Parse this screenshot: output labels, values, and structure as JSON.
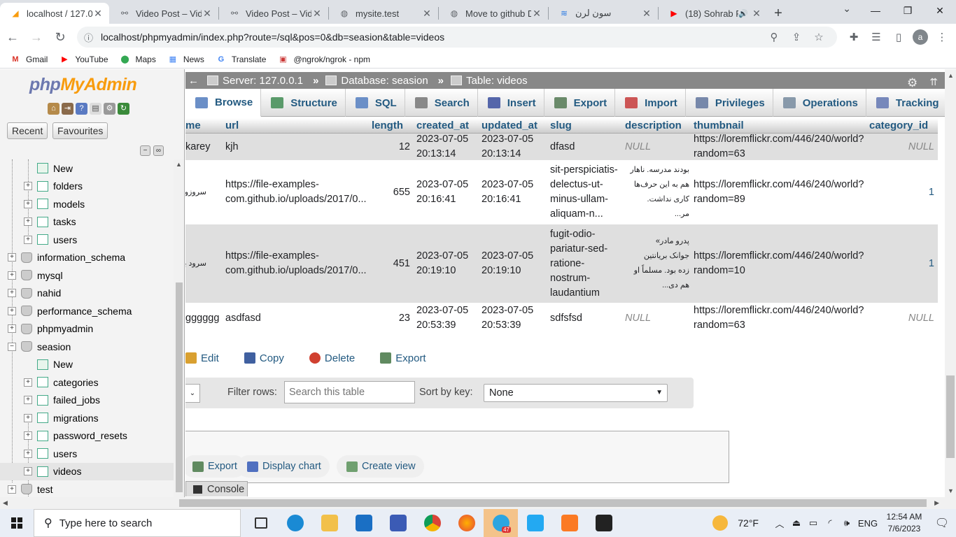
{
  "browser": {
    "tabs": [
      {
        "title": "localhost / 127.0.0",
        "icon": "phpmyadmin-favicon",
        "active": true
      },
      {
        "title": "Video Post – Vide",
        "icon": "link-icon"
      },
      {
        "title": "Video Post – Vide",
        "icon": "link-icon"
      },
      {
        "title": "mysite.test",
        "icon": "globe-icon"
      },
      {
        "title": "Move to github D",
        "icon": "globe-icon"
      },
      {
        "title": "سون لرن",
        "icon": "sevenlearn-favicon"
      },
      {
        "title": "(18) Sohrab P",
        "icon": "youtube-favicon"
      }
    ],
    "url": "localhost/phpmyadmin/index.php?route=/sql&pos=0&db=seasion&table=videos",
    "avatar_letter": "a",
    "bookmarks": [
      {
        "label": "Gmail",
        "icon": "gmail-icon"
      },
      {
        "label": "YouTube",
        "icon": "youtube-icon"
      },
      {
        "label": "Maps",
        "icon": "maps-icon"
      },
      {
        "label": "News",
        "icon": "news-icon"
      },
      {
        "label": "Translate",
        "icon": "translate-icon"
      },
      {
        "label": "@ngrok/ngrok - npm",
        "icon": "npm-icon"
      }
    ]
  },
  "pma": {
    "logo_php": "php",
    "logo_myadmin": "MyAdmin",
    "recent_label": "Recent",
    "favourites_label": "Favourites",
    "tree": [
      {
        "label": "New",
        "level": 2,
        "kind": "new"
      },
      {
        "label": "folders",
        "level": 2,
        "kind": "table"
      },
      {
        "label": "models",
        "level": 2,
        "kind": "table"
      },
      {
        "label": "tasks",
        "level": 2,
        "kind": "table"
      },
      {
        "label": "users",
        "level": 2,
        "kind": "table"
      },
      {
        "label": "information_schema",
        "level": 1,
        "kind": "db"
      },
      {
        "label": "mysql",
        "level": 1,
        "kind": "db"
      },
      {
        "label": "nahid",
        "level": 1,
        "kind": "db"
      },
      {
        "label": "performance_schema",
        "level": 1,
        "kind": "db"
      },
      {
        "label": "phpmyadmin",
        "level": 1,
        "kind": "db"
      },
      {
        "label": "seasion",
        "level": 1,
        "kind": "db-open"
      },
      {
        "label": "New",
        "level": 2,
        "kind": "new"
      },
      {
        "label": "categories",
        "level": 2,
        "kind": "table"
      },
      {
        "label": "failed_jobs",
        "level": 2,
        "kind": "table"
      },
      {
        "label": "migrations",
        "level": 2,
        "kind": "table"
      },
      {
        "label": "password_resets",
        "level": 2,
        "kind": "table"
      },
      {
        "label": "users",
        "level": 2,
        "kind": "table"
      },
      {
        "label": "videos",
        "level": 2,
        "kind": "table",
        "selected": true
      },
      {
        "label": "test",
        "level": 1,
        "kind": "db"
      }
    ],
    "breadcrumb": {
      "server": "Server: 127.0.0.1",
      "database": "Database: seasion",
      "table": "Table: videos"
    },
    "tabs": [
      {
        "label": "Browse",
        "active": true,
        "color": "#6b8fc7"
      },
      {
        "label": "Structure",
        "color": "#5a9a6a"
      },
      {
        "label": "SQL",
        "color": "#6b8fc7"
      },
      {
        "label": "Search",
        "color": "#888"
      },
      {
        "label": "Insert",
        "color": "#5566aa"
      },
      {
        "label": "Export",
        "color": "#6a8a6a"
      },
      {
        "label": "Import",
        "color": "#c55"
      },
      {
        "label": "Privileges",
        "color": "#7788aa"
      },
      {
        "label": "Operations",
        "color": "#8899aa"
      },
      {
        "label": "Tracking",
        "color": "#7788bb"
      }
    ],
    "columns": [
      "me",
      "url",
      "length",
      "created_at",
      "updated_at",
      "slug",
      "description",
      "thumbnail",
      "category_id"
    ],
    "rows": [
      {
        "name": "karey",
        "url": "kjh",
        "length": "12",
        "created_date": "2023-07-05",
        "created_time": "20:13:14",
        "updated_date": "2023-07-05",
        "updated_time": "20:13:14",
        "slug": "dfasd",
        "description": "NULL",
        "thumb1": "https://loremflickr.com/446/240/world?",
        "thumb2": "random=63",
        "category_id": "NULL"
      },
      {
        "name": "سروزو ع",
        "url1": "https://file-examples-",
        "url2": "com.github.io/uploads/2017/0...",
        "length": "655",
        "created_date": "2023-07-05",
        "created_time": "20:16:41",
        "updated_date": "2023-07-05",
        "updated_time": "20:16:41",
        "slug": [
          "sit-perspiciatis-",
          "delectus-ut-",
          "minus-ullam-",
          "aliquam-n..."
        ],
        "description": [
          "بودند مدرسه. ناهار",
          "هم به این حرف‌ها",
          "کاری نداشت.",
          "مر..."
        ],
        "thumb1": "https://loremflickr.com/446/240/world?",
        "thumb2": "random=89",
        "category_id": "1"
      },
      {
        "name": "سرود بخ",
        "url1": "https://file-examples-",
        "url2": "com.github.io/uploads/2017/0...",
        "length": "451",
        "created_date": "2023-07-05",
        "created_time": "20:19:10",
        "updated_date": "2023-07-05",
        "updated_time": "20:19:10",
        "slug": [
          "fugit-odio-",
          "pariatur-sed-",
          "ratione-",
          "nostrum-",
          "laudantium"
        ],
        "description": [
          "پدرو مادر»",
          "جوانک بریانتین",
          "زده بود. مسلماً او",
          "هم دی..."
        ],
        "thumb1": "https://loremflickr.com/446/240/world?",
        "thumb2": "random=10",
        "category_id": "1"
      },
      {
        "name": "gggggg",
        "url": "asdfasd",
        "length": "23",
        "created_date": "2023-07-05",
        "created_time": "20:53:39",
        "updated_date": "2023-07-05",
        "updated_time": "20:53:39",
        "slug": "sdfsfsd",
        "description": "NULL",
        "thumb1": "https://loremflickr.com/446/240/world?",
        "thumb2": "random=63",
        "category_id": "NULL"
      }
    ],
    "row_actions": [
      "Edit",
      "Copy",
      "Delete",
      "Export"
    ],
    "filter_label": "Filter rows:",
    "search_placeholder": "Search this table",
    "sort_label": "Sort by key:",
    "sort_value": "None",
    "query_ops": [
      "Export",
      "Display chart",
      "Create view"
    ],
    "console_label": "Console"
  },
  "taskbar": {
    "search_placeholder": "Type here to search",
    "temperature": "72°F",
    "language": "ENG",
    "time": "12:54 AM",
    "date": "7/6/2023",
    "telegram_badge": "47"
  }
}
